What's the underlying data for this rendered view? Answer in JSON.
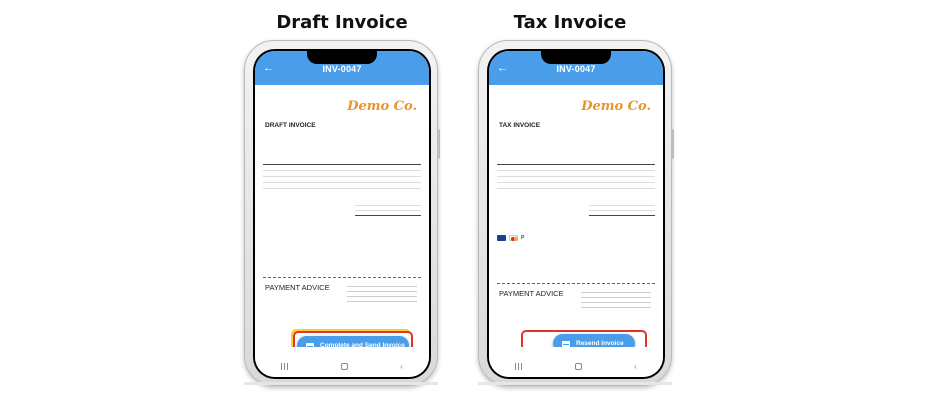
{
  "captions": {
    "left": "Draft Invoice",
    "right": "Tax Invoice"
  },
  "phones": {
    "left": {
      "appbar_title": "INV-0047",
      "logo": "Demo Co.",
      "doc_title": "DRAFT INVOICE",
      "section_title": "PAYMENT ADVICE",
      "action_label": "Complete and Send Invoice"
    },
    "right": {
      "appbar_title": "INV-0047",
      "logo": "Demo Co.",
      "doc_title": "TAX INVOICE",
      "section_title": "PAYMENT ADVICE",
      "action_label": "Resend Invoice"
    }
  },
  "colors": {
    "appbar": "#4a9de8",
    "logo": "#e8962a",
    "highlight": "#e0342b",
    "highlight_outer": "#f6d12b"
  },
  "icons": {
    "back": "arrow-left-icon",
    "action": "mail-icon"
  }
}
